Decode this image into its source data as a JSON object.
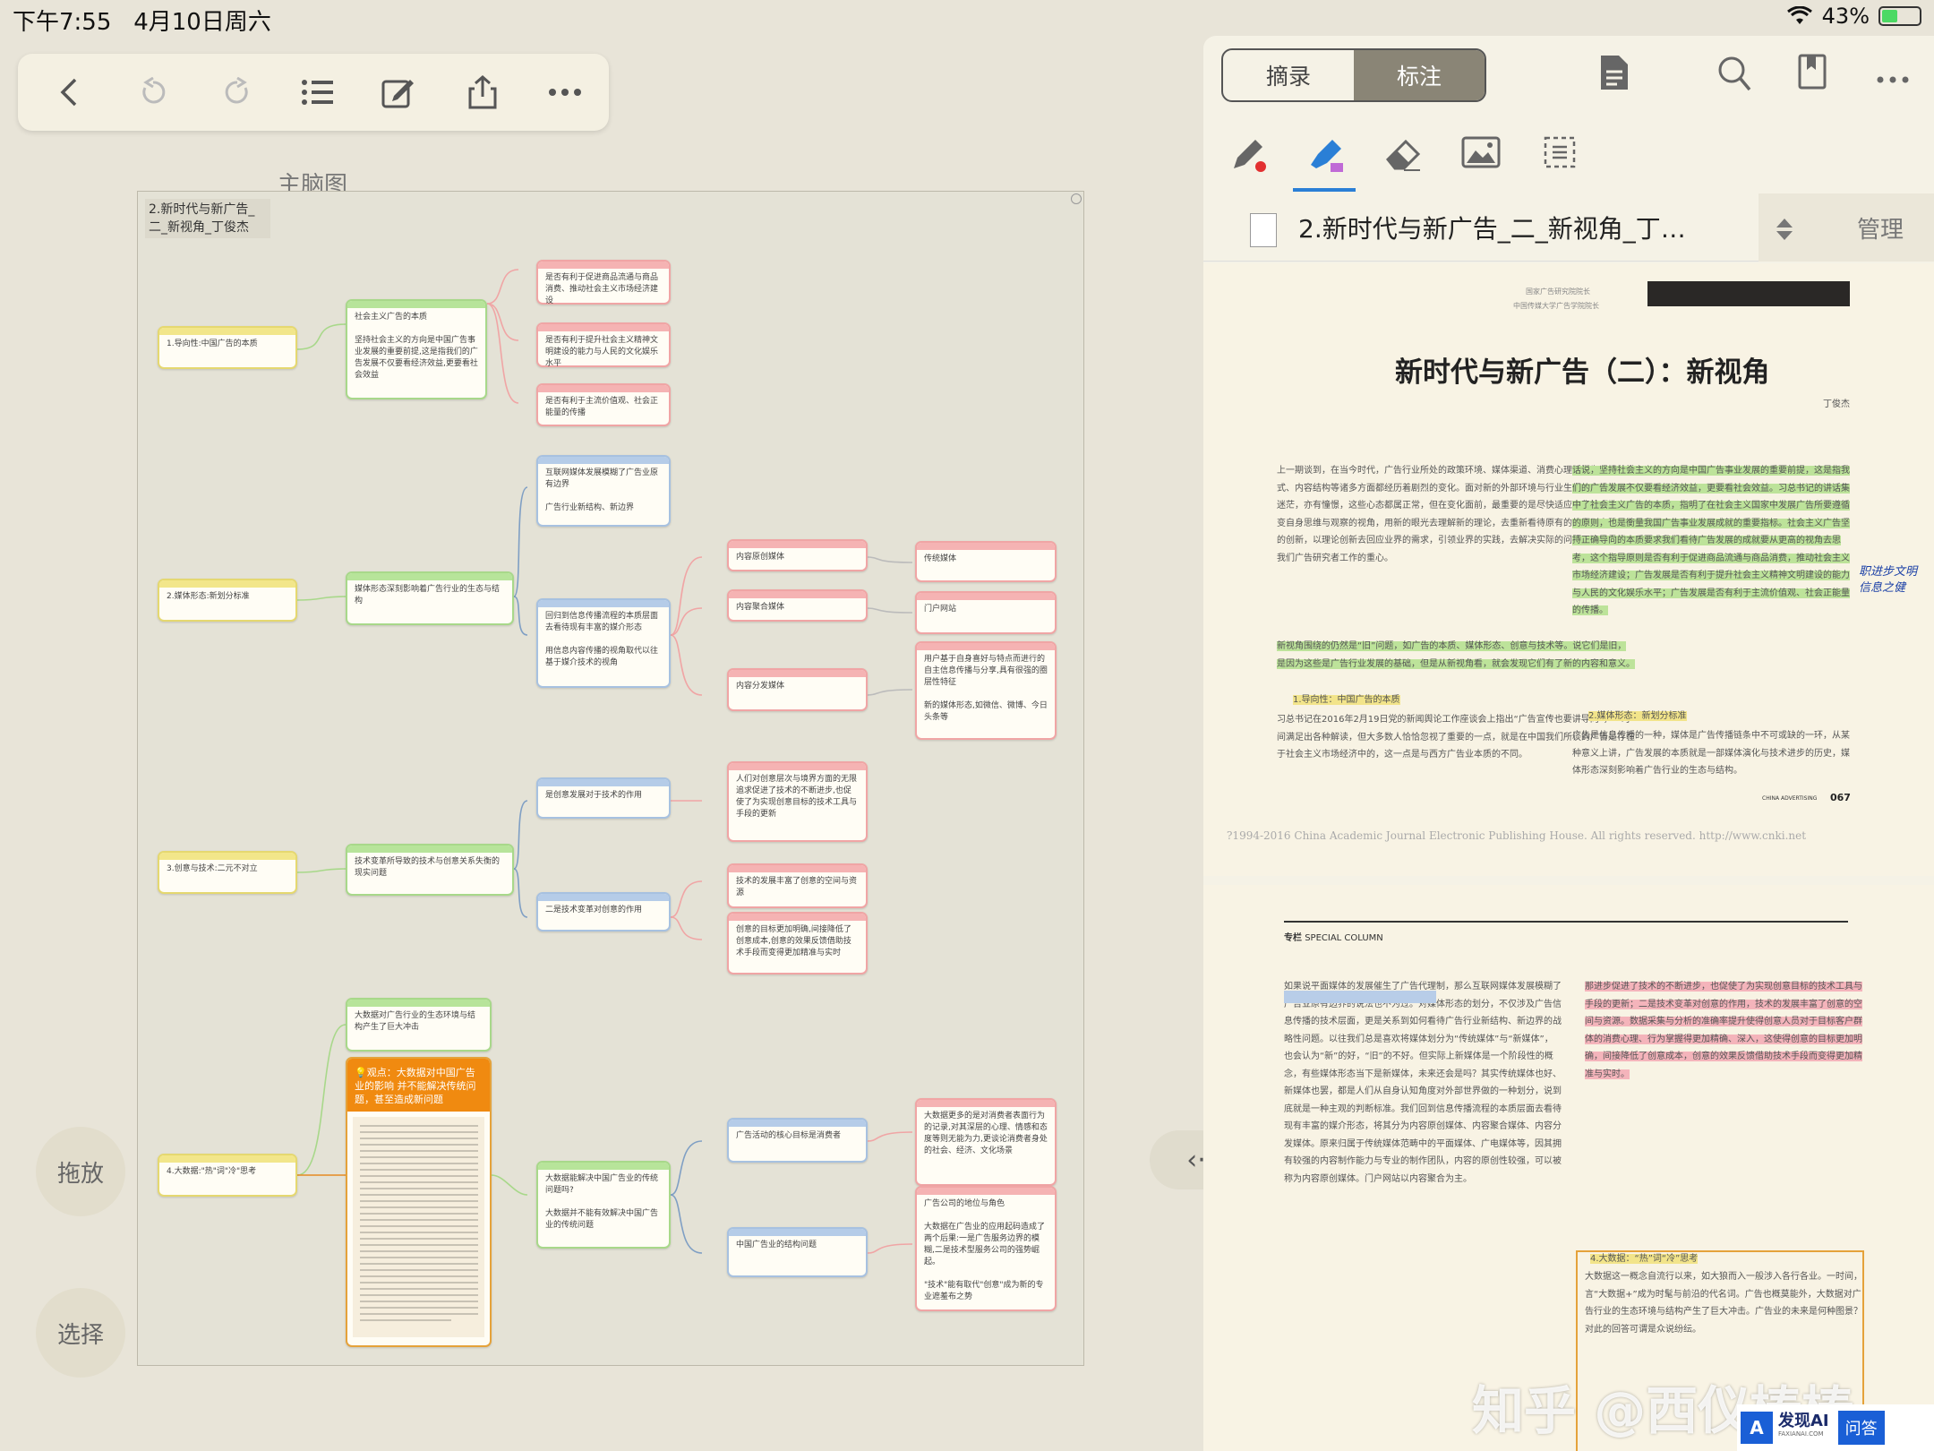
{
  "status": {
    "time": "下午7:55",
    "date": "4月10日周六",
    "battery": "43%",
    "battery_level": 0.43
  },
  "toolbar": {
    "icons": [
      "back-icon",
      "undo-icon",
      "redo-icon",
      "outline-list-icon",
      "edit-icon",
      "share-icon",
      "more-icon"
    ]
  },
  "map": {
    "label": "主脑图",
    "root": "2.新时代与新广告_二_新视角_丁俊杰",
    "n1": "1.导向性:中国广告的本质",
    "n1a": "社会主义广告的本质\n\n坚持社会主义的方向是中国广告事业发展的重要前提,这是指我们的广告发展不仅要看经济效益,更要看社会效益",
    "n1a1": "是否有利于促进商品流通与商品消费、推动社会主义市场经济建设",
    "n1a2": "是否有利于提升社会主义精神文明建设的能力与人民的文化娱乐水平",
    "n1a3": "是否有利于主流价值观、社会正能量的传播",
    "n2": "2.媒体形态:新划分标准",
    "n2a": "媒体形态深刻影响着广告行业的生态与结构",
    "n2a1": "互联网媒体发展模糊了广告业原有边界\n\n广告行业新结构、新边界",
    "n2a2": "回归到信息传播流程的本质层面去看待现有丰富的媒介形态\n\n用信息内容传播的视角取代以往基于媒介技术的视角",
    "n2b1": "内容原创媒体",
    "n2b2": "内容聚合媒体",
    "n2b3": "内容分发媒体",
    "n2c1": "传统媒体",
    "n2c2": "门户网站",
    "n2c3": "用户基于自身喜好与特点而进行的自主信息传播与分享,具有很强的圈层性特征\n\n新的媒体形态,如微信、微博、今日头条等",
    "n3": "3.创意与技术:二元不对立",
    "n3a": "技术变革所导致的技术与创意关系失衡的现实问题",
    "n3a1": "是创意发展对于技术的作用",
    "n3a2": "二是技术变革对创意的作用",
    "n3b1": "人们对创意层次与境界方面的无限追求促进了技术的不断进步,也促使了为实现创意目标的技术工具与手段的更新",
    "n3b2": "技术的发展丰富了创意的空间与资源",
    "n3b3": "创意的目标更加明确,间接降低了创意成本,创意的效果反馈借助技术手段而变得更加精准与实时",
    "n4": "4.大数据:\"热\"词\"冷\"思考",
    "n4a": "大数据对广告行业的生态环境与结构产生了巨大冲击",
    "n4b_title": "💡观点：大数据对中国广告业的影响 并不能解决传统问题，甚至造成新问题",
    "n4b_body": "大数据概念……",
    "n4c": "大数据能解决中国广告业的传统问题吗?\n\n大数据并不能有效解决中国广告业的传统问题",
    "n4c1": "广告活动的核心目标是消费者",
    "n4c2": "中国广告业的结构问题",
    "n4d1": "大数据更多的是对消费者表面行为的记录,对其深层的心理、情感和态度等则无能为力,更谈论消费者身处的社会、经济、文化场景",
    "n4d2": "广告公司的地位与角色\n\n大数据在广告业的应用起码造成了两个后果:一是广告服务边界的模糊,二是技术型服务公司的强势崛起。\n\n\"技术\"能有取代\"创意\"成为新的专业遮羞布之势"
  },
  "side": {
    "drag": "拖放",
    "select": "选择"
  },
  "panel": {
    "tab_excerpt": "摘录",
    "tab_annotate": "标注",
    "doc_title": "2.新时代与新广告_二_新视角_丁…",
    "manage": "管理",
    "page1": {
      "affil1": "国家广告研究院院长",
      "affil2": "中国传媒大学广告学院院长",
      "title": "新时代与新广告（二）：新视角",
      "author": "丁俊杰",
      "handwritten": "职进步文明\n信息之健",
      "col1": "上一期谈到，在当今时代，广告行业所处的政策环境、媒体渠道、消费心理与行为、运营模式、内容结构等诸多方面都经历着剧烈的变化。面对新的外部环境与行业生态，有恐慌、有迷茫，亦有憧憬，这些心态都属正常，但在变化面前，最重要的是尽快适应变化的环境，改变自身思维与观察的视角，用新的眼光去理解新的理论，去重新看待原有的观点、实践理论的创新，以理论创新去回应业界的需求，引领业界的实践，去解决实际的问题，这也是当下我们广告研究者工作的重心。",
      "col1b": "新视角围绕的仍然是“旧”问题，如广告的本质、媒体形态、创意与技术等。说它们是旧，是因为这些是广告行业发展的基础，但是从新视角看，就会发现它们有了新的内容和意义。",
      "sec1": "1.导向性：中国广告的本质",
      "col1c": "习总书记在2016年2月19日党的新闻舆论工作座谈会上指出“广告宣传也要讲导向”，一时间满足出各种解读，但大多数人恰恰忽视了重要的一点，就是在中国我们所谈的广告是存在于社会主义市场经济中的，这一点是与西方广告业本质的不同。",
      "col2": "话说，坚持社会主义的方向是中国广告事业发展的重要前提，这是指我们的广告发展不仅要看经济效益，更要看社会效益。习总书记的讲话集中了社会主义广告的本质，指明了在社会主义国家中发展广告所要遵循的原则，也是衡量我国广告事业发展成就的重要指标。社会主义广告坚持正确导向的本质要求我们看待广告发展的成就要从更高的视角去思考，这个指导原则是否有利于促进商品流通与商品消费，推动社会主义市场经济建设；广告发展是否有利于提升社会主义精神文明建设的能力与人民的文化娱乐水平；广告发展是否有利于主流价值观、社会正能量的传播。",
      "sec2": "2.媒体形态：新划分标准",
      "col2b": "广告是信息传播的一种，媒体是广告传播链条中不可或缺的一环，从某种意义上讲，广告发展的本质就是一部媒体演化与技术进步的历史，媒体形态深刻影响着广告行业的生态与结构。",
      "foot_ca": "CHINA ADVERTISING",
      "page_no": "067",
      "cnki": "?1994-2016 China Academic Journal Electronic Publishing House. All rights reserved.    http://www.cnki.net"
    },
    "page2": {
      "header_mark": "专栏",
      "header_text": "SPECIAL COLUMN",
      "colA": "如果说平面媒体的发展催生了广告代理制，那么互联网媒体发展模糊了广告业原有边界的说法也不为过。对媒体形态的划分，不仅涉及广告信息传播的技术层面，更是关系到如何看待广告行业新结构、新边界的战略性问题。以往我们总是喜欢将媒体划分为“传统媒体”与“新媒体”，也会认为“新”的好，“旧”的不好。但实际上新媒体是一个阶段性的概念，有些媒体形态当下是新媒体，未来还会是吗？其实传统媒体也好、新媒体也罢，都是人们从自身认知角度对外部世界做的一种划分，说到底就是一种主观的判断标准。我们回到信息传播流程的本质层面去看待现有丰富的媒介形态，将其分为内容原创媒体、内容聚合媒体、内容分发媒体。原来归属于传统媒体范畴中的平面媒体、广电媒体等，因其拥有较强的内容制作能力与专业的制作团队，内容的原创性较强，可以被称为内容原创媒体。门户网站以内容聚合为主。",
      "colB": "那进步促进了技术的不断进步，也促使了为实现创意目标的技术工具与手段的更新；二是技术变革对创意的作用，技术的发展丰富了创意的空间与资源。数据采集与分析的准确率提升使得创意人员对于目标客户群体的消费心理、行为掌握得更加精确、深入，这使得创意的目标更加明确，间接降低了创意成本，创意的效果反馈借助技术手段而变得更加精准与实时。",
      "sec4": "4.大数据：“热”词“冷”思考",
      "colB2": "大数据这一概念自流行以来，如大狼而入一般涉入各行各业。一时间，言“大数据+”成为时髦与前沿的代名词。广告也概莫能外，大数据对广告行业的生态环境与结构产生了巨大冲击。广告业的未来是何种图景？对此的回答可谓是众说纷纭。",
      "watermark": "知乎 @西仪榛榛",
      "brand": "发现AI",
      "brand_sub": "FAXIANAI.COM",
      "brand_btn": "问答"
    }
  },
  "handle_glyph": "‹·›"
}
